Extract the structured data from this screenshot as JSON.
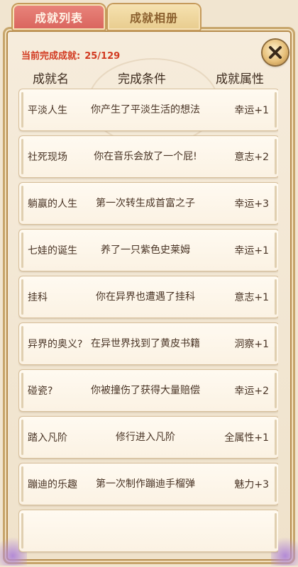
{
  "tabs": [
    {
      "label": "成就列表"
    },
    {
      "label": "成就相册"
    }
  ],
  "progress": {
    "label": "当前完成成就:",
    "value": "25/129"
  },
  "columns": {
    "name": "成就名",
    "condition": "完成条件",
    "attribute": "成就属性"
  },
  "achievements": [
    {
      "name": "平淡人生",
      "condition": "你产生了平淡生活的想法",
      "attribute": "幸运+1"
    },
    {
      "name": "社死现场",
      "condition": "你在音乐会放了一个屁!",
      "attribute": "意志+2"
    },
    {
      "name": "躺赢的人生",
      "condition": "第一次转生成首富之子",
      "attribute": "幸运+3"
    },
    {
      "name": "七娃的诞生",
      "condition": "养了一只紫色史莱姆",
      "attribute": "幸运+1"
    },
    {
      "name": "挂科",
      "condition": "你在异界也遭遇了挂科",
      "attribute": "意志+1"
    },
    {
      "name": "异界的奥义?",
      "condition": "在异世界找到了黄皮书籍",
      "attribute": "洞察+1"
    },
    {
      "name": "碰瓷?",
      "condition": "你被撞伤了获得大量赔偿",
      "attribute": "幸运+2"
    },
    {
      "name": "踏入凡阶",
      "condition": "修行进入凡阶",
      "attribute": "全属性+1"
    },
    {
      "name": "蹦迪的乐趣",
      "condition": "第一次制作蹦迪手榴弹",
      "attribute": "魅力+3"
    },
    {
      "name": "",
      "condition": "",
      "attribute": ""
    }
  ],
  "icons": {
    "close": "close-icon"
  },
  "colors": {
    "accent_red": "#d23b22",
    "tab_active": "#de6b62",
    "tab_inactive": "#eed39a",
    "frame_gold": "#b58b4c"
  }
}
